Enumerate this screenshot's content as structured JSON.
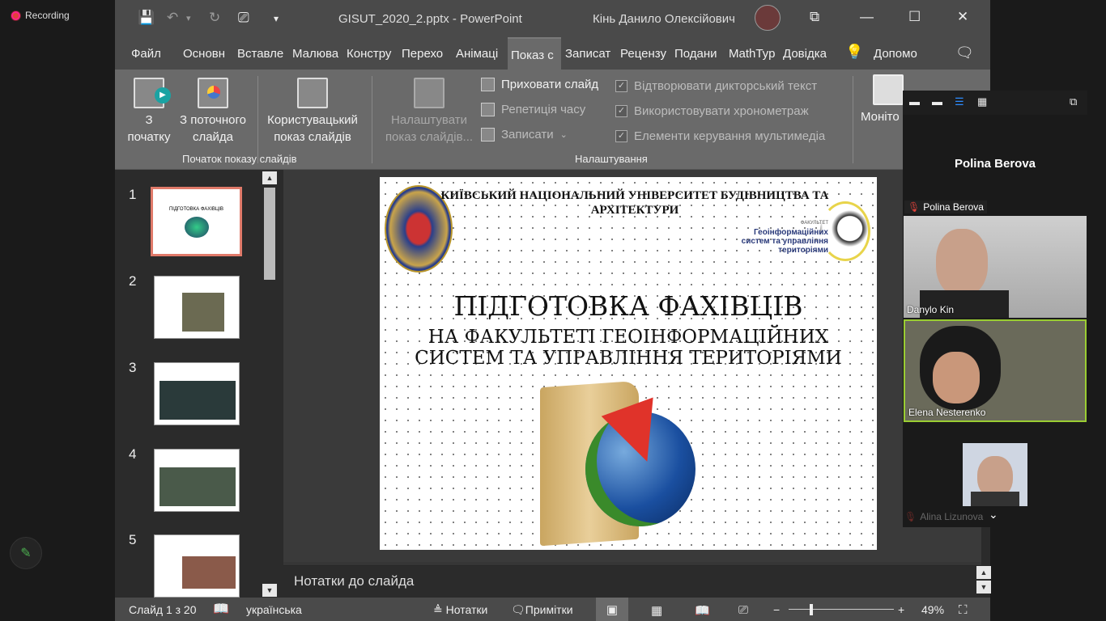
{
  "recording": {
    "label": "Recording"
  },
  "window": {
    "title": "GISUT_2020_2.pptx  -  PowerPoint",
    "user": "Кінь Данило Олексійович"
  },
  "tabs": [
    "Файл",
    "Основн",
    "Вставле",
    "Малюва",
    "Констру",
    "Перехо",
    "Анімаці",
    "Показ с",
    "Записат",
    "Рецензу",
    "Подани",
    "MathTyp",
    "Довідка"
  ],
  "active_tab": "Показ с",
  "search": {
    "label": "Допомо"
  },
  "ribbon": {
    "from_start": "З початку",
    "from_current": "З поточного слайда",
    "custom_show": "Користувацький показ слайдів",
    "group_start": "Початок показу слайдів",
    "setup": "Налаштувати показ слайдів...",
    "hide_slide": "Приховати слайд",
    "rehearse": "Репетиція часу",
    "record": "Записати",
    "play_narration": "Відтворювати дикторський текст",
    "use_timings": "Використовувати хронометраж",
    "media_controls": "Елементи керування мультимедіа",
    "group_setup": "Налаштування",
    "monitor": "Моніто"
  },
  "thumbnails": [
    "1",
    "2",
    "3",
    "4",
    "5"
  ],
  "slide": {
    "university": "КИЇВСЬКИЙ НАЦІОНАЛЬНИЙ УНІВЕРСИТЕТ БУДІВНИЦТВА ТА  АРХІТЕКТУРИ",
    "faculty_small": "ФАКУЛЬТЕТ",
    "faculty": "Геоінформаційних систем та управління територіями",
    "title": "ПІДГОТОВКА ФАХІВЦІВ",
    "subtitle_1": "НА ФАКУЛЬТЕТІ ГЕОІНФОРМАЦІЙНИХ",
    "subtitle_2": "СИСТЕМ ТА УПРАВЛІННЯ ТЕРИТОРІЯМИ"
  },
  "notes": {
    "placeholder": "Нотатки до слайда"
  },
  "status": {
    "slide_info": "Слайд 1 з 20",
    "language": "українська",
    "notes_btn": "Нотатки",
    "comments_btn": "Примітки",
    "zoom": "49%"
  },
  "zoom_panel": {
    "speaker": "Polina Berova",
    "participants": [
      {
        "name": "Polina Berova",
        "muted": true
      },
      {
        "name": "Danylo Kin",
        "muted": false
      },
      {
        "name": "Elena Nesterenko",
        "muted": false
      },
      {
        "name": "Alina Lizunova",
        "muted": true
      }
    ]
  }
}
